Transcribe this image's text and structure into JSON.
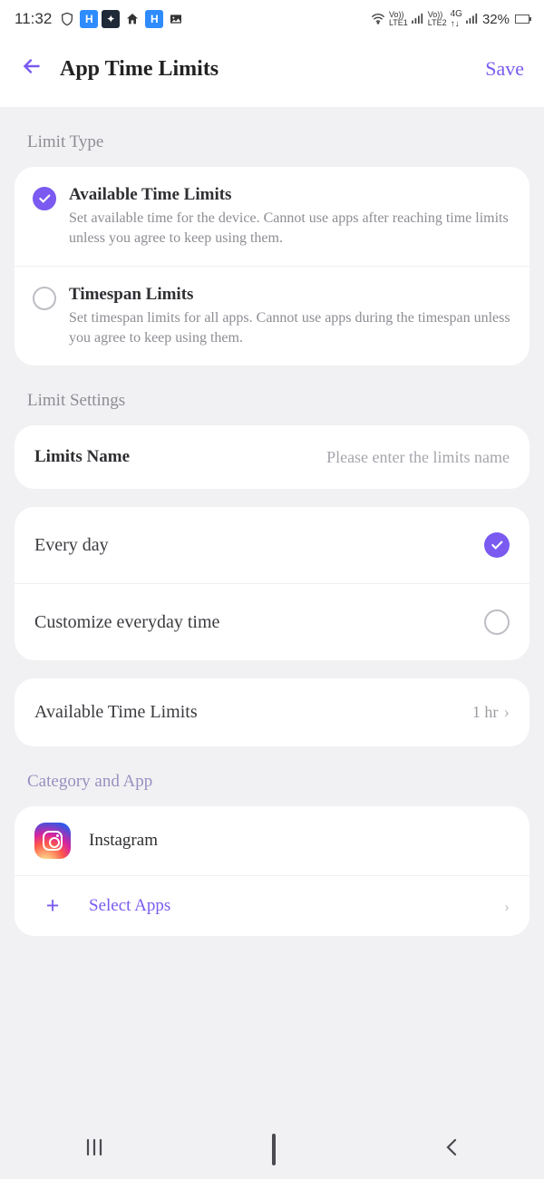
{
  "status": {
    "time": "11:32",
    "battery_pct": "32%"
  },
  "header": {
    "title": "App Time Limits",
    "save_label": "Save"
  },
  "limit_type": {
    "section_label": "Limit Type",
    "options": [
      {
        "title": "Available Time Limits",
        "desc": "Set available time for the device. Cannot use apps after reaching time limits unless you agree to keep using them.",
        "selected": true
      },
      {
        "title": "Timespan Limits",
        "desc": "Set timespan limits for all apps. Cannot use apps during the timespan unless you agree to keep using them.",
        "selected": false
      }
    ]
  },
  "limit_settings": {
    "section_label": "Limit Settings",
    "name_label": "Limits Name",
    "name_placeholder": "Please enter the limits name",
    "name_value": "",
    "schedule": {
      "every_day_label": "Every day",
      "every_day_selected": true,
      "customize_label": "Customize everyday time",
      "customize_selected": false
    },
    "available_time": {
      "label": "Available Time Limits",
      "value": "1 hr"
    }
  },
  "category": {
    "section_label": "Category and App",
    "apps": [
      {
        "name": "Instagram"
      }
    ],
    "select_label": "Select Apps"
  }
}
